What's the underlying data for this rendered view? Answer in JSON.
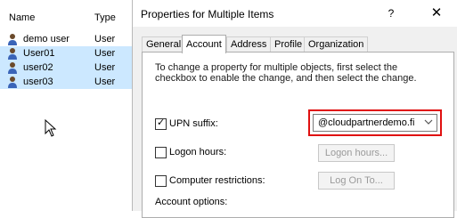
{
  "list": {
    "columns": {
      "name": "Name",
      "type": "Type"
    },
    "rows": [
      {
        "name": "demo user",
        "type": "User",
        "selected": false
      },
      {
        "name": "User01",
        "type": "User",
        "selected": true
      },
      {
        "name": "user02",
        "type": "User",
        "selected": true
      },
      {
        "name": "user03",
        "type": "User",
        "selected": true
      }
    ]
  },
  "dialog": {
    "title": "Properties for Multiple Items",
    "help_label": "?",
    "close_label": "✕",
    "tabs": [
      {
        "label": "General",
        "active": false
      },
      {
        "label": "Account",
        "active": true
      },
      {
        "label": "Address",
        "active": false
      },
      {
        "label": "Profile",
        "active": false
      },
      {
        "label": "Organization",
        "active": false
      }
    ],
    "intro_text": "To change a property for multiple objects, first select the checkbox to enable the change, and then select the change.",
    "upn": {
      "label": "UPN suffix:",
      "checked": true,
      "value": "@cloudpartnerdemo.fi"
    },
    "logon_hours": {
      "label": "Logon hours:",
      "checked": false,
      "button_label": "Logon hours..."
    },
    "computer_restrictions": {
      "label": "Computer restrictions:",
      "checked": false,
      "button_label": "Log On To..."
    },
    "account_options_label": "Account options:"
  },
  "colors": {
    "highlight": "#e01010",
    "selection": "#cce8ff"
  }
}
